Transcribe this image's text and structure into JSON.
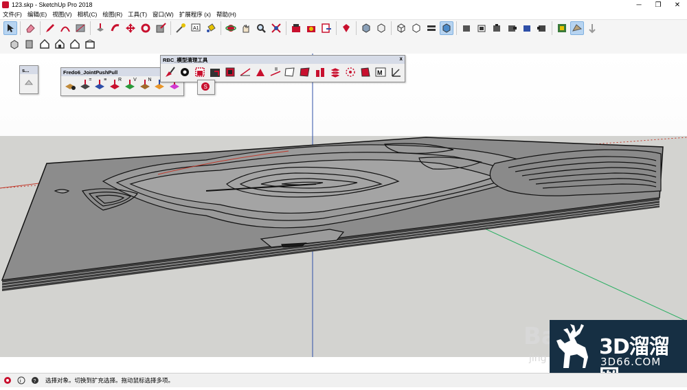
{
  "window": {
    "title": "123.skp - SketchUp Pro 2018",
    "minimize": "─",
    "maximize": "❐",
    "close": "✕"
  },
  "menu": [
    "文件(F)",
    "编辑(E)",
    "视图(V)",
    "相机(C)",
    "绘图(R)",
    "工具(T)",
    "窗口(W)",
    "扩展程序 (x)",
    "帮助(H)"
  ],
  "toolbars": {
    "row1_icons": [
      "select-icon",
      "eraser-icon",
      "pencil-icon",
      "arc-icon",
      "rectangle-icon",
      "push-pull-icon",
      "follow-me-icon",
      "move-icon",
      "rotate-icon",
      "scale-icon",
      "tape-measure-icon",
      "text-icon",
      "paint-bucket-icon",
      "orbit-icon",
      "pan-icon",
      "zoom-icon",
      "zoom-extents-icon",
      "warehouse-icon",
      "extension-warehouse-icon",
      "send-to-layout-icon",
      "ruby-icon",
      "xray-icon",
      "back-edges-icon",
      "wireframe-icon",
      "hidden-line-icon",
      "shaded-icon",
      "shaded-textures-icon",
      "monochrome-icon",
      "style-1-icon",
      "style-2-icon",
      "style-3-icon",
      "style-4-icon",
      "style-5-icon",
      "style-6-icon",
      "shadow-icon",
      "fog-icon",
      "sandbox-icon"
    ],
    "row2_icons": [
      "iso-view-icon",
      "front-view-icon",
      "home-view-icon",
      "right-view-icon",
      "back-view-icon",
      "left-view-icon"
    ]
  },
  "panels": {
    "small": {
      "title": "s..."
    },
    "fredo": {
      "title": "Fredo6_JointPushPull",
      "letters": [
        "",
        "=",
        "≡",
        "R",
        "V",
        "N",
        "",
        ""
      ]
    },
    "rbc": {
      "title": "RBC_模型清理工具",
      "close": "x"
    }
  },
  "status": {
    "text": "选择对象。切换到扩充选择。拖动鼠标选择多项。"
  },
  "watermark": {
    "brand": "3D溜溜网",
    "url": "3D66.COM",
    "bg_text": "Ba",
    "bg_text2": "jing"
  },
  "colors": {
    "accent_red": "#c8102e",
    "panel_header": "#d6dbe7",
    "axis_red": "#c0392b",
    "axis_green": "#27ae60",
    "axis_blue": "#2e4fa8"
  }
}
